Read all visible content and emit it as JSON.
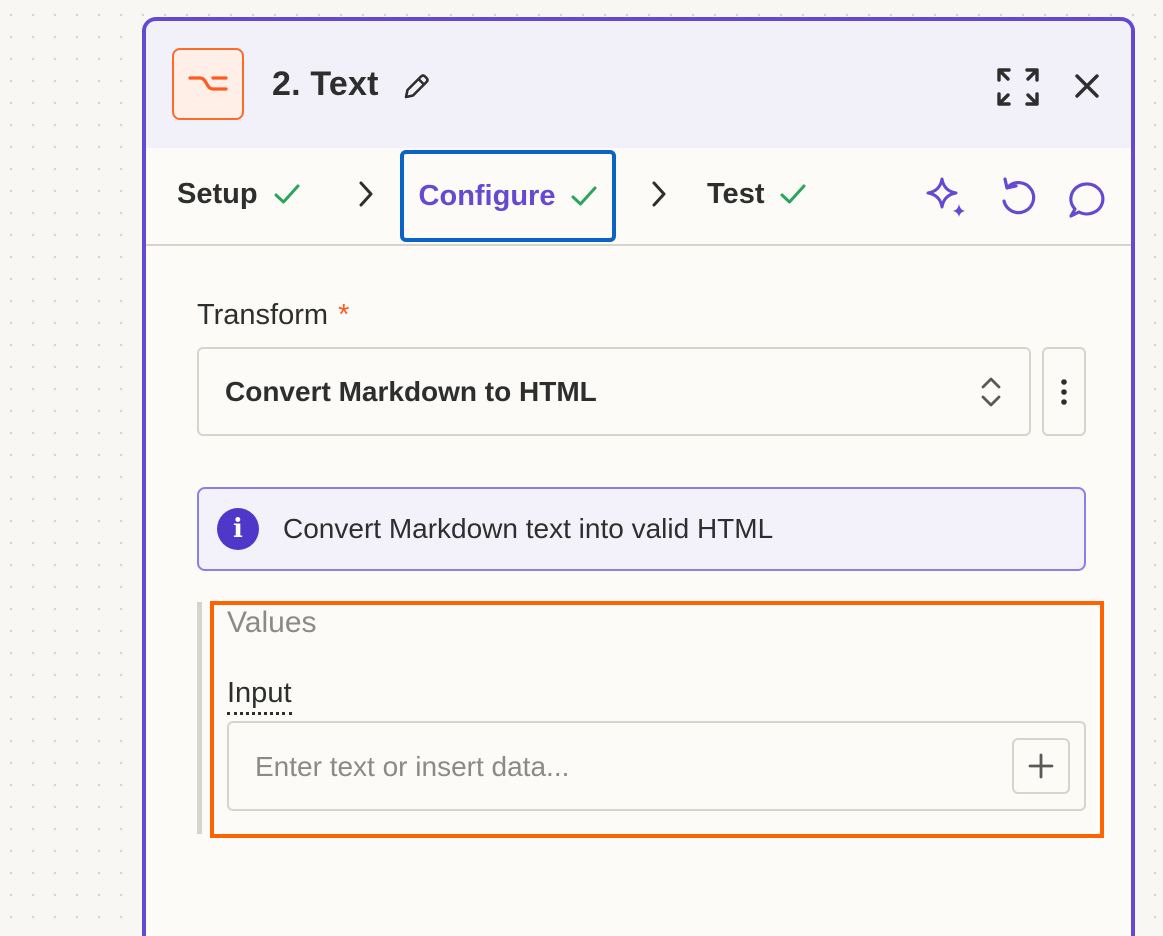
{
  "step": {
    "title": "2. Text",
    "app_icon": "text-transform-icon"
  },
  "header_actions": {
    "expand_icon": "expand-icon",
    "close_icon": "close-icon"
  },
  "tabs": [
    {
      "label": "Setup",
      "done": true
    },
    {
      "label": "Configure",
      "done": true,
      "active": true
    },
    {
      "label": "Test",
      "done": true
    }
  ],
  "toolbar": {
    "icons": [
      "ai-sparkle-icon",
      "undo-icon",
      "comment-icon"
    ]
  },
  "transform": {
    "label": "Transform",
    "required_mark": "*",
    "value": "Convert Markdown to HTML"
  },
  "info": {
    "text": "Convert Markdown text into valid HTML"
  },
  "values": {
    "section_title": "Values",
    "input_label": "Input",
    "input_placeholder": "Enter text or insert data...",
    "input_value": ""
  },
  "colors": {
    "accent": "#6549d2",
    "brand_orange": "#ff6a2b",
    "check_green": "#2aa55a",
    "focus_blue": "#0b63c5",
    "highlight_orange": "#ff6200"
  }
}
